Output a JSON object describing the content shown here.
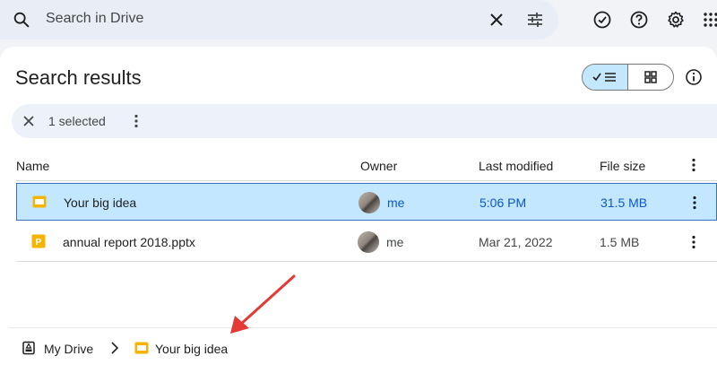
{
  "search": {
    "placeholder": "Search in Drive"
  },
  "page": {
    "title": "Search results"
  },
  "selection": {
    "count_label": "1 selected"
  },
  "columns": {
    "name": "Name",
    "owner": "Owner",
    "modified": "Last modified",
    "size": "File size"
  },
  "rows": [
    {
      "name": "Your big idea",
      "owner": "me",
      "modified": "5:06 PM",
      "size": "31.5 MB",
      "type": "slides-icon",
      "selected": true
    },
    {
      "name": "annual report 2018.pptx",
      "owner": "me",
      "modified": "Mar 21, 2022",
      "size": "1.5 MB",
      "type": "pptx-icon",
      "selected": false
    }
  ],
  "breadcrumb": {
    "root": "My Drive",
    "current": "Your big idea"
  },
  "colors": {
    "accent": "#0b57d0",
    "selected_bg": "#c2e7ff",
    "slides_yellow": "#f4b400",
    "annotation_arrow": "#e53935"
  }
}
